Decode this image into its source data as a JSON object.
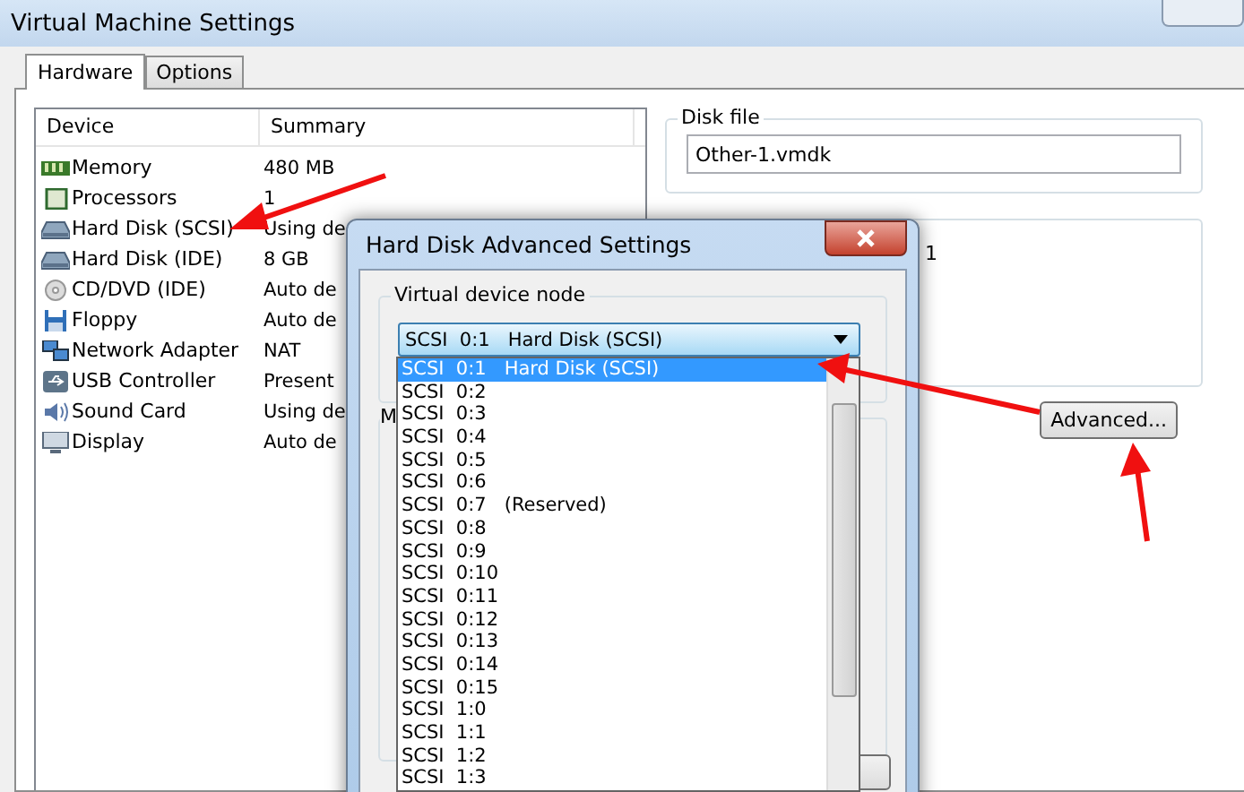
{
  "window": {
    "title": "Virtual Machine Settings"
  },
  "tabs": [
    {
      "label": "Hardware",
      "selected": true
    },
    {
      "label": "Options",
      "selected": false
    }
  ],
  "device_list": {
    "columns": [
      "Device",
      "Summary"
    ],
    "rows": [
      {
        "kind": "memory",
        "device": "Memory",
        "summary": "480 MB"
      },
      {
        "kind": "processor",
        "device": "Processors",
        "summary": "1"
      },
      {
        "kind": "disk",
        "device": "Hard Disk (SCSI)",
        "summary": "Using de"
      },
      {
        "kind": "disk",
        "device": "Hard Disk (IDE)",
        "summary": "8 GB"
      },
      {
        "kind": "cd",
        "device": "CD/DVD (IDE)",
        "summary": "Auto de"
      },
      {
        "kind": "floppy",
        "device": "Floppy",
        "summary": "Auto de"
      },
      {
        "kind": "network",
        "device": "Network Adapter",
        "summary": "NAT"
      },
      {
        "kind": "usb",
        "device": "USB Controller",
        "summary": "Present"
      },
      {
        "kind": "sound",
        "device": "Sound Card",
        "summary": "Using de"
      },
      {
        "kind": "display",
        "device": "Display",
        "summary": "Auto de"
      }
    ]
  },
  "disk_file": {
    "label": "Disk file",
    "value": "Other-1.vmdk"
  },
  "capacity_fragment": "1",
  "advanced_button": "Advanced...",
  "dialog": {
    "title": "Hard Disk Advanced Settings",
    "group_label": "Virtual device node",
    "combo_value": "SCSI  0:1   Hard Disk (SCSI)",
    "second_group_label": "M",
    "options": [
      {
        "text": "SCSI  0:1   Hard Disk (SCSI)",
        "selected": true
      },
      {
        "text": "SCSI  0:2",
        "selected": false
      },
      {
        "text": "SCSI  0:3",
        "selected": false
      },
      {
        "text": "SCSI  0:4",
        "selected": false
      },
      {
        "text": "SCSI  0:5",
        "selected": false
      },
      {
        "text": "SCSI  0:6",
        "selected": false
      },
      {
        "text": "SCSI  0:7   (Reserved)",
        "selected": false
      },
      {
        "text": "SCSI  0:8",
        "selected": false
      },
      {
        "text": "SCSI  0:9",
        "selected": false
      },
      {
        "text": "SCSI  0:10",
        "selected": false
      },
      {
        "text": "SCSI  0:11",
        "selected": false
      },
      {
        "text": "SCSI  0:12",
        "selected": false
      },
      {
        "text": "SCSI  0:13",
        "selected": false
      },
      {
        "text": "SCSI  0:14",
        "selected": false
      },
      {
        "text": "SCSI  0:15",
        "selected": false
      },
      {
        "text": "SCSI  1:0",
        "selected": false
      },
      {
        "text": "SCSI  1:1",
        "selected": false
      },
      {
        "text": "SCSI  1:2",
        "selected": false
      },
      {
        "text": "SCSI  1:3",
        "selected": false
      }
    ]
  }
}
